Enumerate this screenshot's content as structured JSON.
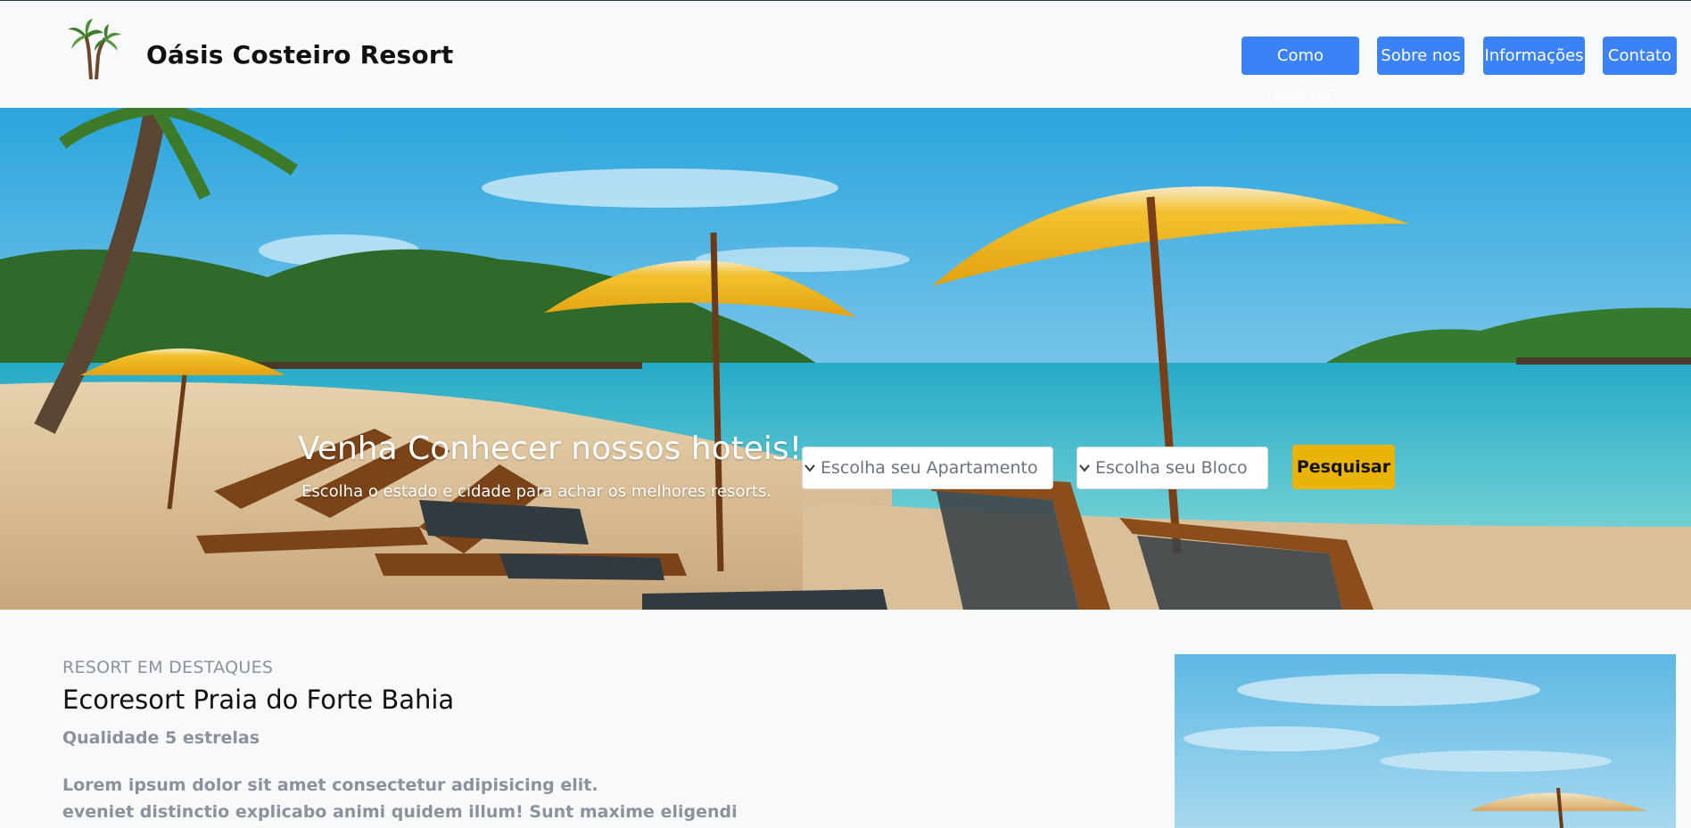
{
  "header": {
    "brand": "Oásis Costeiro Resort",
    "logo_icon": "palm-tree-icon",
    "nav": [
      {
        "label": "Como reservar"
      },
      {
        "label": "Sobre nos"
      },
      {
        "label": "Informações"
      },
      {
        "label": "Contato"
      }
    ]
  },
  "hero": {
    "title": "Venha Conhecer nossos hoteis!",
    "subtitle": "Escolha o estado e cidade para achar os melhores resorts.",
    "select_apartment": "Escolha seu Apartamento",
    "select_block": "Escolha seu Bloco",
    "search_label": "Pesquisar",
    "image_icon": "beach-umbrella-image"
  },
  "featured": {
    "eyebrow": "RESORT EM DESTAQUES",
    "name": "Ecoresort Praia do Forte Bahia",
    "quality": "Qualidade 5 estrelas",
    "description_line1": "Lorem ipsum dolor sit amet consectetur adipisicing elit.",
    "description_line2": "eveniet distinctio explicabo animi quidem illum! Sunt maxime eligendi"
  },
  "colors": {
    "nav_blue": "#3b82f6",
    "search_yellow": "#eab308",
    "page_bg": "#f8f9fb"
  }
}
